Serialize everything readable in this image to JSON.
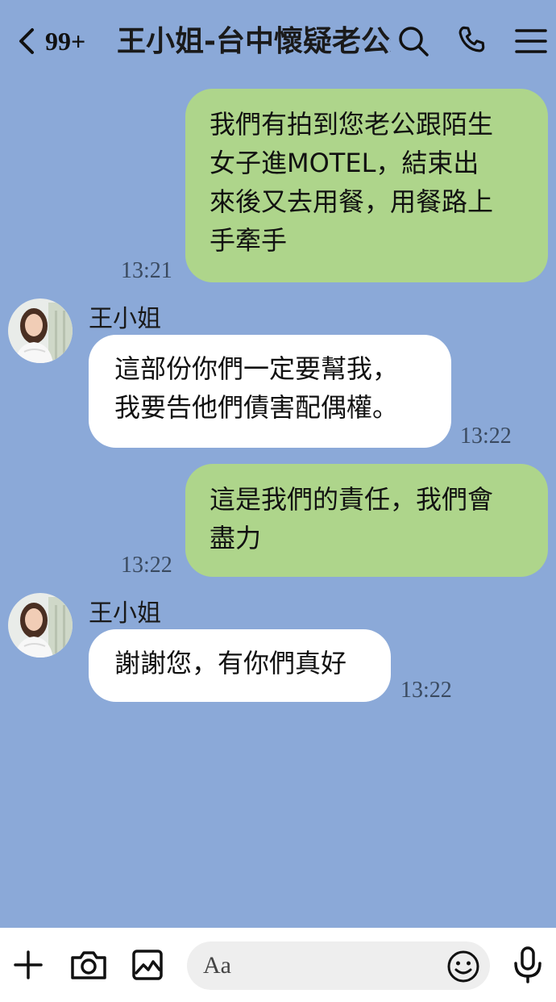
{
  "header": {
    "back_count": "99+",
    "title": "王小姐-台中懷疑老公外遇",
    "icons": [
      "chevron-left-icon",
      "search-icon",
      "phone-icon",
      "menu-icon"
    ]
  },
  "messages": [
    {
      "side": "out",
      "text_lines": [
        "我們有拍到您老公跟陌生",
        "女子進MOTEL，結束出",
        "來後又去用餐，用餐路上",
        "手牽手"
      ],
      "time": "13:21"
    },
    {
      "side": "in",
      "sender": "王小姐",
      "text_lines": [
        "這部份你們一定要幫我，",
        "我要告他們債害配偶權。"
      ],
      "time": "13:22"
    },
    {
      "side": "out",
      "text_lines": [
        "這是我們的責任，我們會",
        "盡力"
      ],
      "time": "13:22"
    },
    {
      "side": "in",
      "sender": "王小姐",
      "text_lines": [
        "謝謝您，有你們真好"
      ],
      "time": "13:22"
    }
  ],
  "input": {
    "placeholder": "Aa"
  },
  "bottom_icons": [
    "plus-icon",
    "camera-icon",
    "image-icon",
    "emoji-icon",
    "microphone-icon"
  ],
  "colors": {
    "background": "#8BA9D8",
    "outgoing_bubble": "#AED58B",
    "incoming_bubble": "#FFFFFF"
  }
}
